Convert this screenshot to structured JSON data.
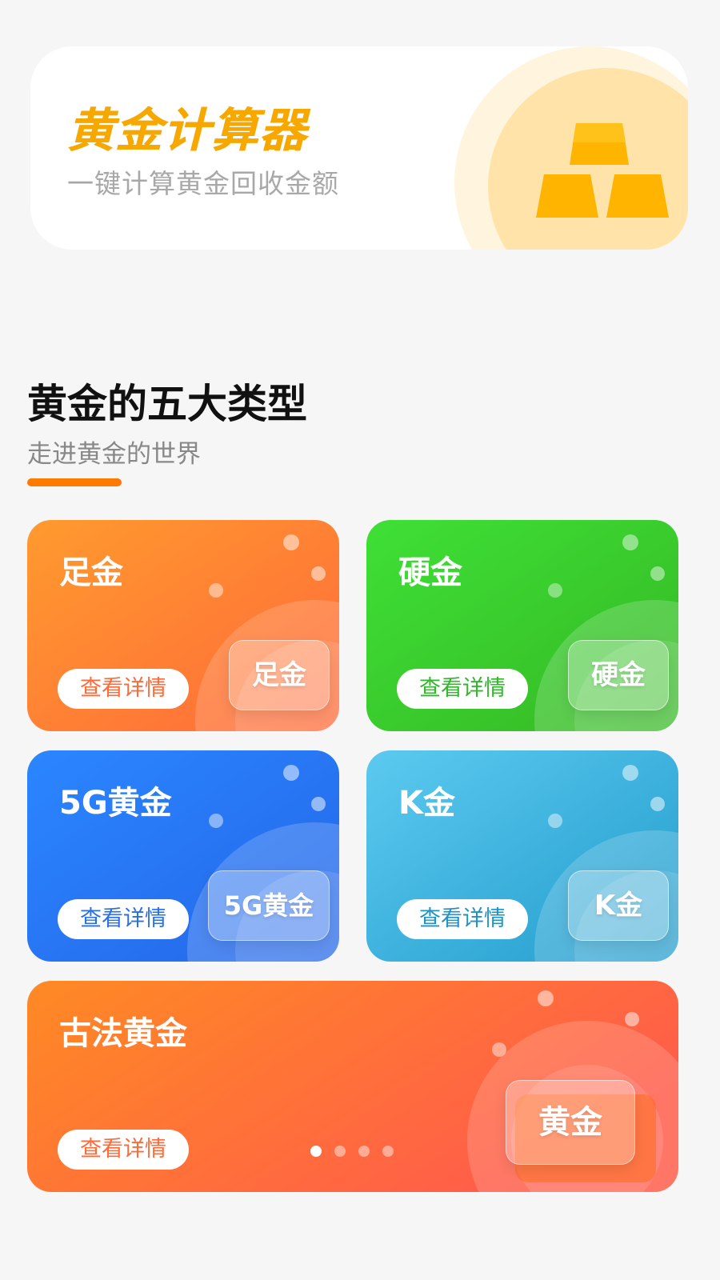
{
  "hero": {
    "title": "黄金计算器",
    "subtitle": "一键计算黄金回收金额"
  },
  "section": {
    "title": "黄金的五大类型",
    "subtitle": "走进黄金的世界"
  },
  "cards": [
    {
      "title": "足金",
      "tag": "足金",
      "button": "查看详情",
      "color_from": "#ff9a2e",
      "color_to": "#ff6a3a",
      "button_text_color": "#ff6a3a"
    },
    {
      "title": "硬金",
      "tag": "硬金",
      "button": "查看详情",
      "color_from": "#3fe036",
      "color_to": "#35b824",
      "button_text_color": "#2fb82a"
    },
    {
      "title": "5G黄金",
      "tag": "5G黄金",
      "button": "查看详情",
      "color_from": "#2b86ff",
      "color_to": "#2466e8",
      "button_text_color": "#2a6ee8"
    },
    {
      "title": "K金",
      "tag": "K金",
      "button": "查看详情",
      "color_from": "#5ccaf0",
      "color_to": "#229ccc",
      "button_text_color": "#1f92c8"
    },
    {
      "title": "古法黄金",
      "tag": "黄金",
      "button": "查看详情",
      "color_from": "#ff8a24",
      "color_to": "#ff5c4a",
      "button_text_color": "#ff6a3a"
    }
  ],
  "pagination": {
    "count": 4,
    "active_index": 0
  }
}
